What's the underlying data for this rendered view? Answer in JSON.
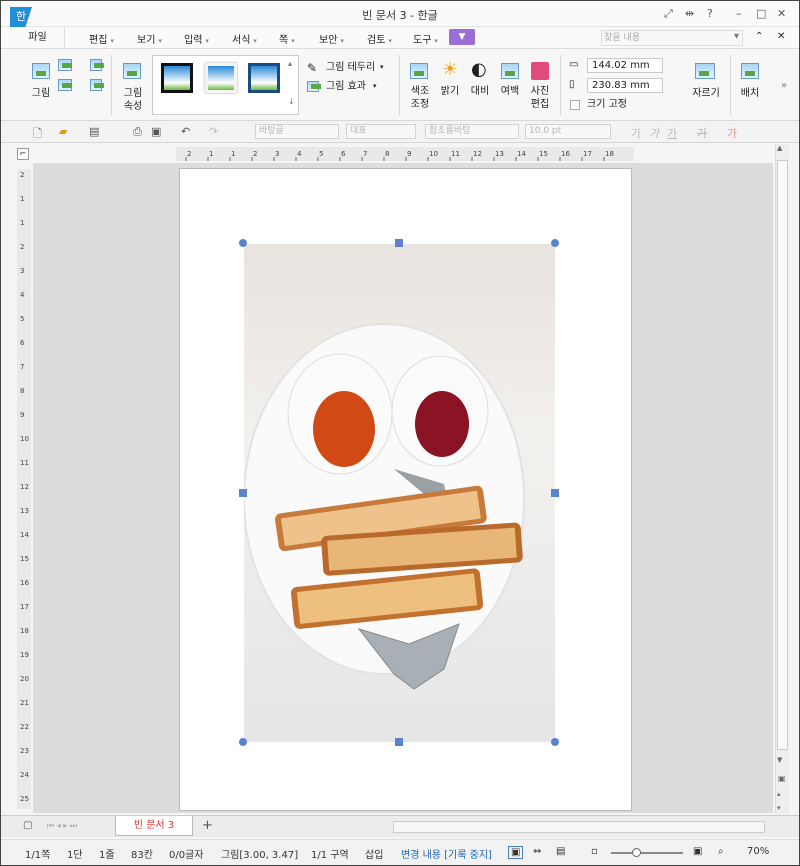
{
  "window": {
    "title": "빈 문서 3 - 한글",
    "logo": "한",
    "help": "?"
  },
  "menu": {
    "file": "파일",
    "items": [
      "편집",
      "보기",
      "입력",
      "서식",
      "쪽",
      "보안",
      "검토",
      "도구"
    ],
    "search_placeholder": "찾을 내용"
  },
  "ribbon": {
    "picture": "그림",
    "picture_props": [
      "그림",
      "속성"
    ],
    "border": "그림 테두리",
    "effect": "그림 효과",
    "color_adjust": [
      "색조",
      "조정"
    ],
    "brightness": "밝기",
    "contrast": "대비",
    "margin": "여백",
    "photo_edit": [
      "사진",
      "편집"
    ],
    "width": "144.02",
    "height": "230.83",
    "unit": "mm",
    "lock_size": "크기 고정",
    "crop": "자르기",
    "arrange": "배치"
  },
  "toolbar": {
    "style": "바탕글",
    "para": "대표",
    "font": "함초롬바탕",
    "size": "10.0",
    "size_unit": "pt",
    "bold": "가",
    "italic": "가",
    "underline": "가",
    "strike": "가",
    "color": "가"
  },
  "tabs": {
    "doc": "빈 문서 3",
    "add": "+"
  },
  "status": {
    "page": "1/1쪽",
    "section": "1단",
    "line": "1줄",
    "col": "83칸",
    "chars": "0/0글자",
    "object": "그림[3.00, 3.47]",
    "area": "1/1 구역",
    "mode": "삽입",
    "track": "변경 내용 [기록 중지]",
    "zoom": "70%"
  },
  "ruler": {
    "h": [
      "2",
      "1",
      "1",
      "2",
      "3",
      "4",
      "5",
      "6",
      "7",
      "8",
      "9",
      "10",
      "11",
      "12",
      "13",
      "14",
      "15",
      "16",
      "17",
      "18"
    ],
    "v": [
      "2",
      "1",
      "1",
      "2",
      "3",
      "4",
      "5",
      "6",
      "7",
      "8",
      "9",
      "10",
      "11",
      "12",
      "13",
      "14",
      "15",
      "16",
      "17",
      "18",
      "19",
      "20",
      "21",
      "22",
      "23",
      "24",
      "25"
    ]
  },
  "icons": {
    "zoom": "search-icon",
    "print": "printer-icon",
    "new": "new-document-icon",
    "open": "folder-icon",
    "save": "save-icon",
    "undo": "undo-icon",
    "redo": "redo-icon"
  }
}
